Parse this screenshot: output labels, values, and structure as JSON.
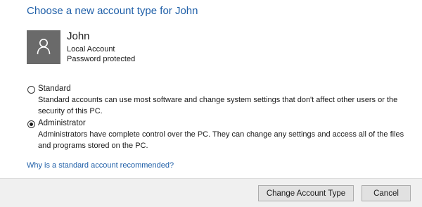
{
  "header": {
    "title": "Choose a new account type for John"
  },
  "account": {
    "avatar_icon": "user-silhouette-icon",
    "name": "John",
    "type": "Local Account",
    "status": "Password protected"
  },
  "options": [
    {
      "label": "Standard",
      "description": "Standard accounts can use most software and change system settings that don't affect other users or the security of this PC.",
      "selected": false
    },
    {
      "label": "Administrator",
      "description": "Administrators have complete control over the PC. They can change any settings and access all of the files and programs stored on the PC.",
      "selected": true
    }
  ],
  "help_link": "Why is a standard account recommended?",
  "buttons": {
    "change": "Change Account Type",
    "cancel": "Cancel"
  },
  "colors": {
    "title": "#1f5fa8",
    "link": "#1f5fa8",
    "avatar_bg": "#6a6a6a",
    "footer_bg": "#f0f0f0"
  }
}
